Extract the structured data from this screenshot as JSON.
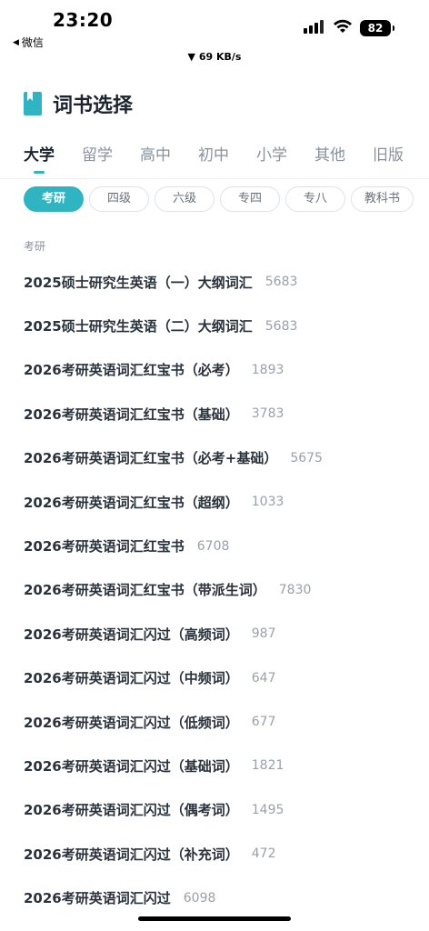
{
  "status_bar": {
    "time": "23:20",
    "back_app": "微信",
    "net_speed": "▼ 69 KB/s",
    "battery": "82"
  },
  "header": {
    "title": "词书选择",
    "icon": "book-icon",
    "accent_color": "#2fb5c1"
  },
  "tabs": [
    "大学",
    "留学",
    "高中",
    "初中",
    "小学",
    "其他",
    "旧版"
  ],
  "active_tab": "大学",
  "chips": [
    "考研",
    "四级",
    "六级",
    "专四",
    "专八",
    "教科书"
  ],
  "active_chip": "考研",
  "section": {
    "label": "考研"
  },
  "books": [
    {
      "name": "2025硕士研究生英语（一）大纲词汇",
      "count": "5683"
    },
    {
      "name": "2025硕士研究生英语（二）大纲词汇",
      "count": "5683"
    },
    {
      "name": "2026考研英语词汇红宝书（必考）",
      "count": "1893"
    },
    {
      "name": "2026考研英语词汇红宝书（基础）",
      "count": "3783"
    },
    {
      "name": "2026考研英语词汇红宝书（必考+基础）",
      "count": "5675"
    },
    {
      "name": "2026考研英语词汇红宝书（超纲）",
      "count": "1033"
    },
    {
      "name": "2026考研英语词汇红宝书",
      "count": "6708"
    },
    {
      "name": "2026考研英语词汇红宝书（带派生词）",
      "count": "7830"
    },
    {
      "name": "2026考研英语词汇闪过（高频词）",
      "count": "987"
    },
    {
      "name": "2026考研英语词汇闪过（中频词）",
      "count": "647"
    },
    {
      "name": "2026考研英语词汇闪过（低频词）",
      "count": "677"
    },
    {
      "name": "2026考研英语词汇闪过（基础词）",
      "count": "1821"
    },
    {
      "name": "2026考研英语词汇闪过（偶考词）",
      "count": "1495"
    },
    {
      "name": "2026考研英语词汇闪过（补充词）",
      "count": "472"
    },
    {
      "name": "2026考研英语词汇闪过",
      "count": "6098"
    }
  ]
}
